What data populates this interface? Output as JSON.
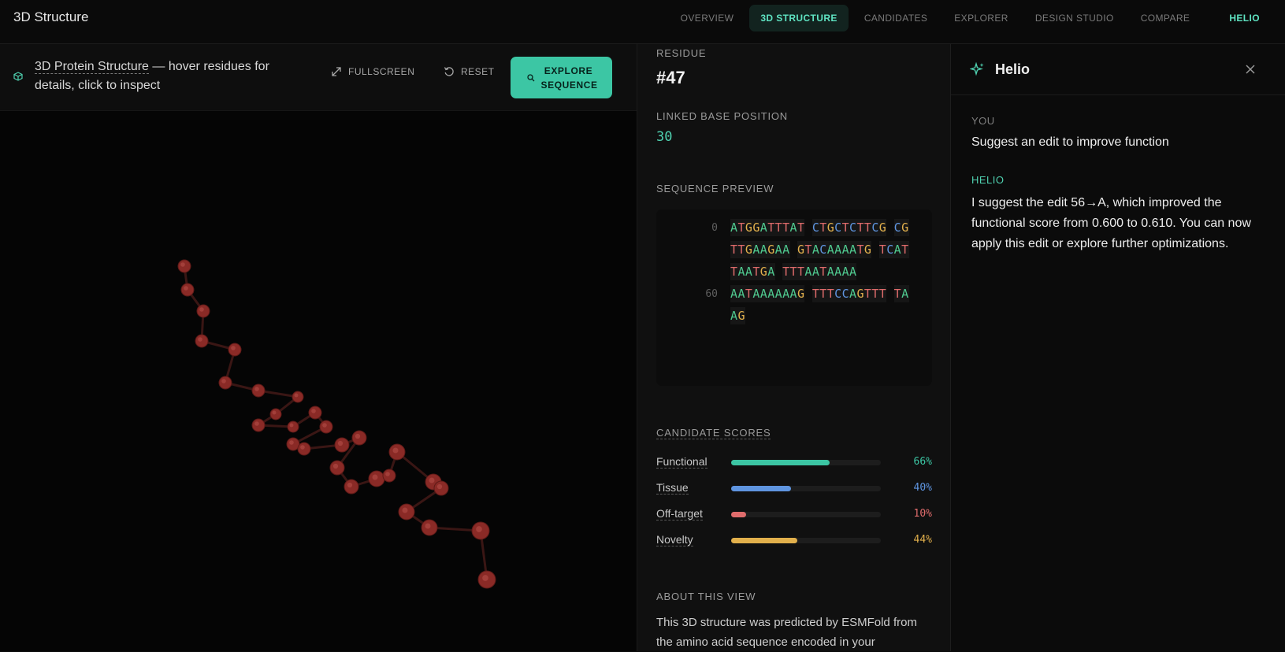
{
  "app": {
    "title": "3D Structure"
  },
  "nav": {
    "tabs": [
      {
        "label": "OVERVIEW"
      },
      {
        "label": "3D STRUCTURE"
      },
      {
        "label": "CANDIDATES"
      },
      {
        "label": "EXPLORER"
      },
      {
        "label": "DESIGN STUDIO"
      },
      {
        "label": "COMPARE"
      },
      {
        "label": "HELIO"
      }
    ]
  },
  "toolbar": {
    "title_dotted": "3D Protein Structure",
    "title_rest": " — hover residues for details, click to inspect",
    "fullscreen": "FULLSCREEN",
    "reset": "RESET",
    "explore": "EXPLORE SEQUENCE"
  },
  "residue": {
    "label": "RESIDUE",
    "value": "#47",
    "linked_label": "LINKED BASE POSITION",
    "linked_value": "30"
  },
  "sequence": {
    "label": "SEQUENCE PREVIEW",
    "rows": [
      {
        "index": "0",
        "text": "ATGGATTTAT CTGCTCTTCG CG"
      },
      {
        "index": "",
        "text": "TTGAAGAA GTACAAAATG TCAT"
      },
      {
        "index": "",
        "text": "TAATGA TTTAATAAAA"
      },
      {
        "index": "60",
        "text": "AATAAAAAAG TTTCCAGTTT TA"
      },
      {
        "index": "",
        "text": "AG"
      }
    ]
  },
  "scores": {
    "label": "CANDIDATE SCORES",
    "items": [
      {
        "name": "Functional",
        "value": 66,
        "display": "66%",
        "color": "#3cc6a4"
      },
      {
        "name": "Tissue",
        "value": 40,
        "display": "40%",
        "color": "#5f95e0"
      },
      {
        "name": "Off-target",
        "value": 10,
        "display": "10%",
        "color": "#e06c6c"
      },
      {
        "name": "Novelty",
        "value": 44,
        "display": "44%",
        "color": "#e2b04c"
      }
    ]
  },
  "about": {
    "label": "ABOUT THIS VIEW",
    "text": "This 3D structure was predicted by ESMFold from the amino acid sequence encoded in your"
  },
  "helio": {
    "title": "Helio",
    "messages": [
      {
        "role": "YOU",
        "text": "Suggest an edit to improve function"
      },
      {
        "role": "HELIO",
        "text": "I suggest the edit 56→A, which improved the functional score from 0.600 to 0.610. You can now apply this edit or explore further optimizations."
      }
    ]
  },
  "colors": {
    "accent": "#3cc6a4",
    "residue": "#8a2a26"
  }
}
